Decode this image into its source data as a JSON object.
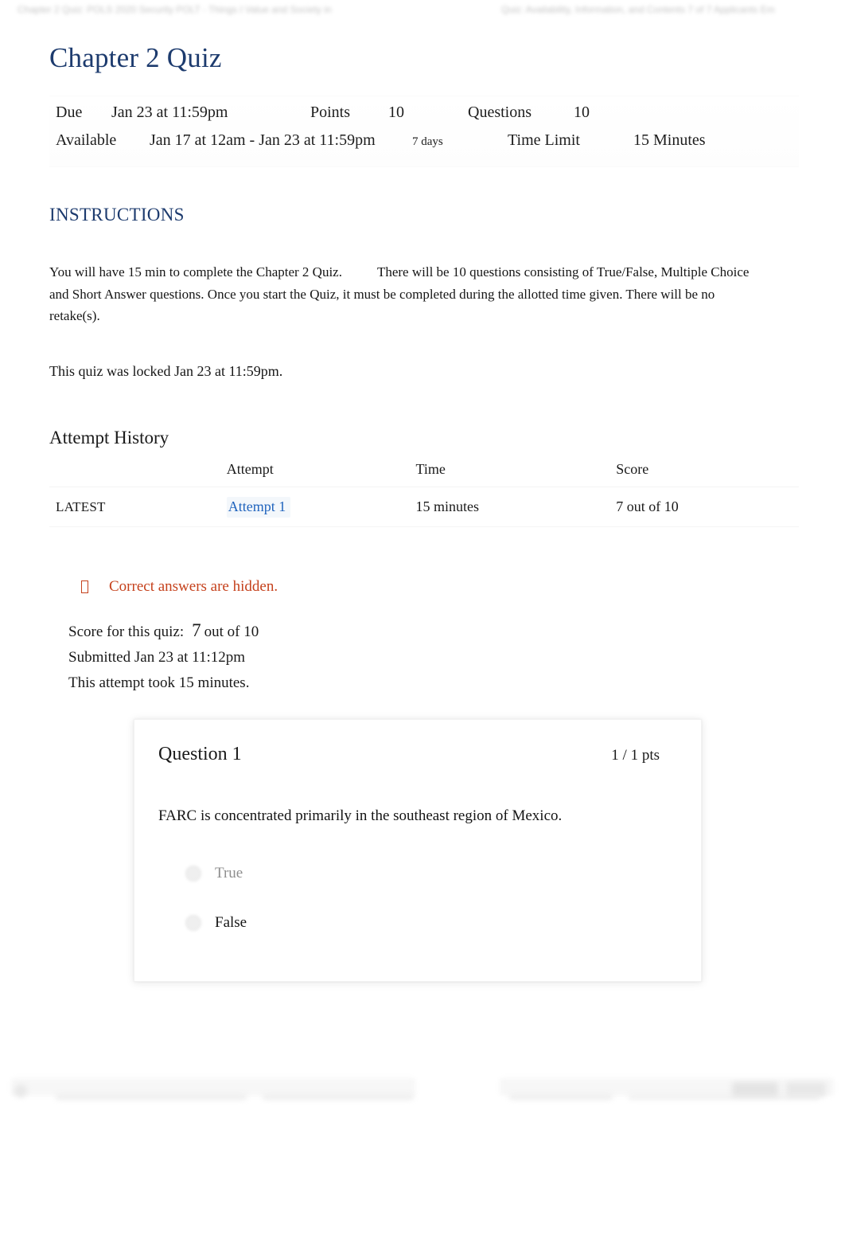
{
  "browser_chrome": {
    "tab_text_left": "Chapter 2 Quiz: POLS 2020 Security POLT - Things I Value and Society in",
    "tab_text_right": "Quiz: Availability, Information, and Contents 7 of 7 Applicants Em"
  },
  "quiz": {
    "title": "Chapter 2 Quiz",
    "info": {
      "due_label": "Due",
      "due_value": "Jan 23 at 11:59pm",
      "points_label": "Points",
      "points_value": "10",
      "questions_label": "Questions",
      "questions_value": "10",
      "available_label": "Available",
      "available_value": "Jan 17 at 12am - Jan 23 at 11:59pm",
      "duration_value": "7 days",
      "time_limit_label": "Time Limit",
      "time_limit_value": "15 Minutes"
    },
    "instructions_heading": "INSTRUCTIONS",
    "instructions_part1": "You will have 15 min to complete the Chapter 2 Quiz.",
    "instructions_part2": "There will be 10 questions consisting of True/False, Multiple Choice and Short Answer questions. Once you start the Quiz, it must be completed during the allotted time given. There will be no retake(s).",
    "locked_message": "This quiz was locked Jan 23 at 11:59pm."
  },
  "attempt_history": {
    "heading": "Attempt History",
    "columns": [
      "",
      "Attempt",
      "Time",
      "Score"
    ],
    "rows": [
      {
        "kept": "LATEST",
        "attempt": "Attempt 1",
        "time": "15 minutes",
        "score": "7 out of 10"
      }
    ]
  },
  "notice": {
    "icon": "info-circle-icon",
    "text": "Correct answers are hidden.",
    "color": "#c5411c"
  },
  "summary": {
    "score_label": "Score for this quiz:",
    "score_value": "7",
    "score_suffix": "out of 10",
    "submitted": "Submitted Jan 23 at 11:12pm",
    "duration": "This attempt took 15 minutes."
  },
  "questions": [
    {
      "title": "Question 1",
      "points": "1 / 1 pts",
      "text": "FARC is concentrated primarily in the southeast region of Mexico.",
      "answers": [
        {
          "label": "True",
          "selected": false
        },
        {
          "label": "False",
          "selected": true
        }
      ]
    }
  ],
  "colors": {
    "heading_blue": "#1d3b6e",
    "link_blue": "#1f63bd",
    "notice_orange": "#c5411c",
    "text_black": "#1a1a1a"
  }
}
